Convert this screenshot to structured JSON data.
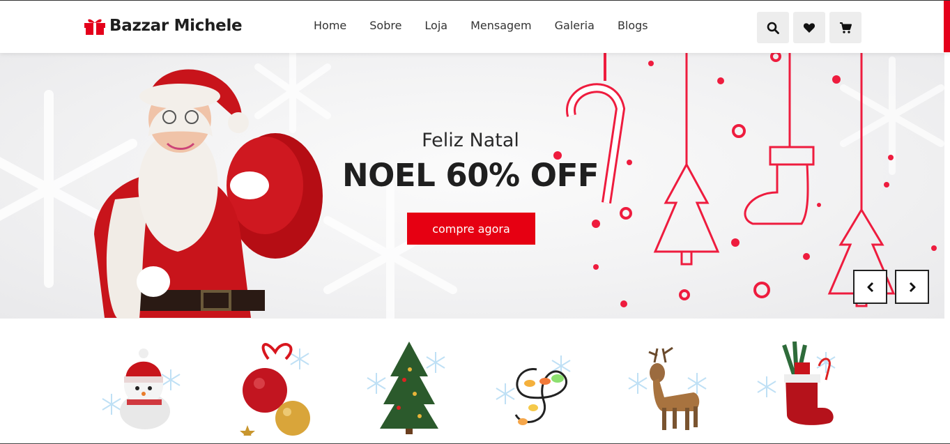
{
  "brand": {
    "name": "Bazzar Michele",
    "accent": "#e4001b",
    "logo_icon": "gift-icon"
  },
  "nav": {
    "items": [
      {
        "label": "Home"
      },
      {
        "label": "Sobre"
      },
      {
        "label": "Loja"
      },
      {
        "label": "Mensagem"
      },
      {
        "label": "Galeria"
      },
      {
        "label": "Blogs"
      }
    ]
  },
  "actions": {
    "icons": [
      "search-icon",
      "heart-icon",
      "cart-icon"
    ]
  },
  "hero": {
    "subtitle": "Feliz Natal",
    "title": "NOEL 60% OFF",
    "cta_label": "compre agora",
    "cta_color": "#e60012",
    "prev_icon": "chevron-left-icon",
    "next_icon": "chevron-right-icon"
  },
  "categories": {
    "items": [
      {
        "icon": "snowman-icon"
      },
      {
        "icon": "ornament-balls-icon"
      },
      {
        "icon": "christmas-tree-icon"
      },
      {
        "icon": "string-lights-icon"
      },
      {
        "icon": "reindeer-icon"
      },
      {
        "icon": "christmas-boot-icon"
      }
    ]
  }
}
